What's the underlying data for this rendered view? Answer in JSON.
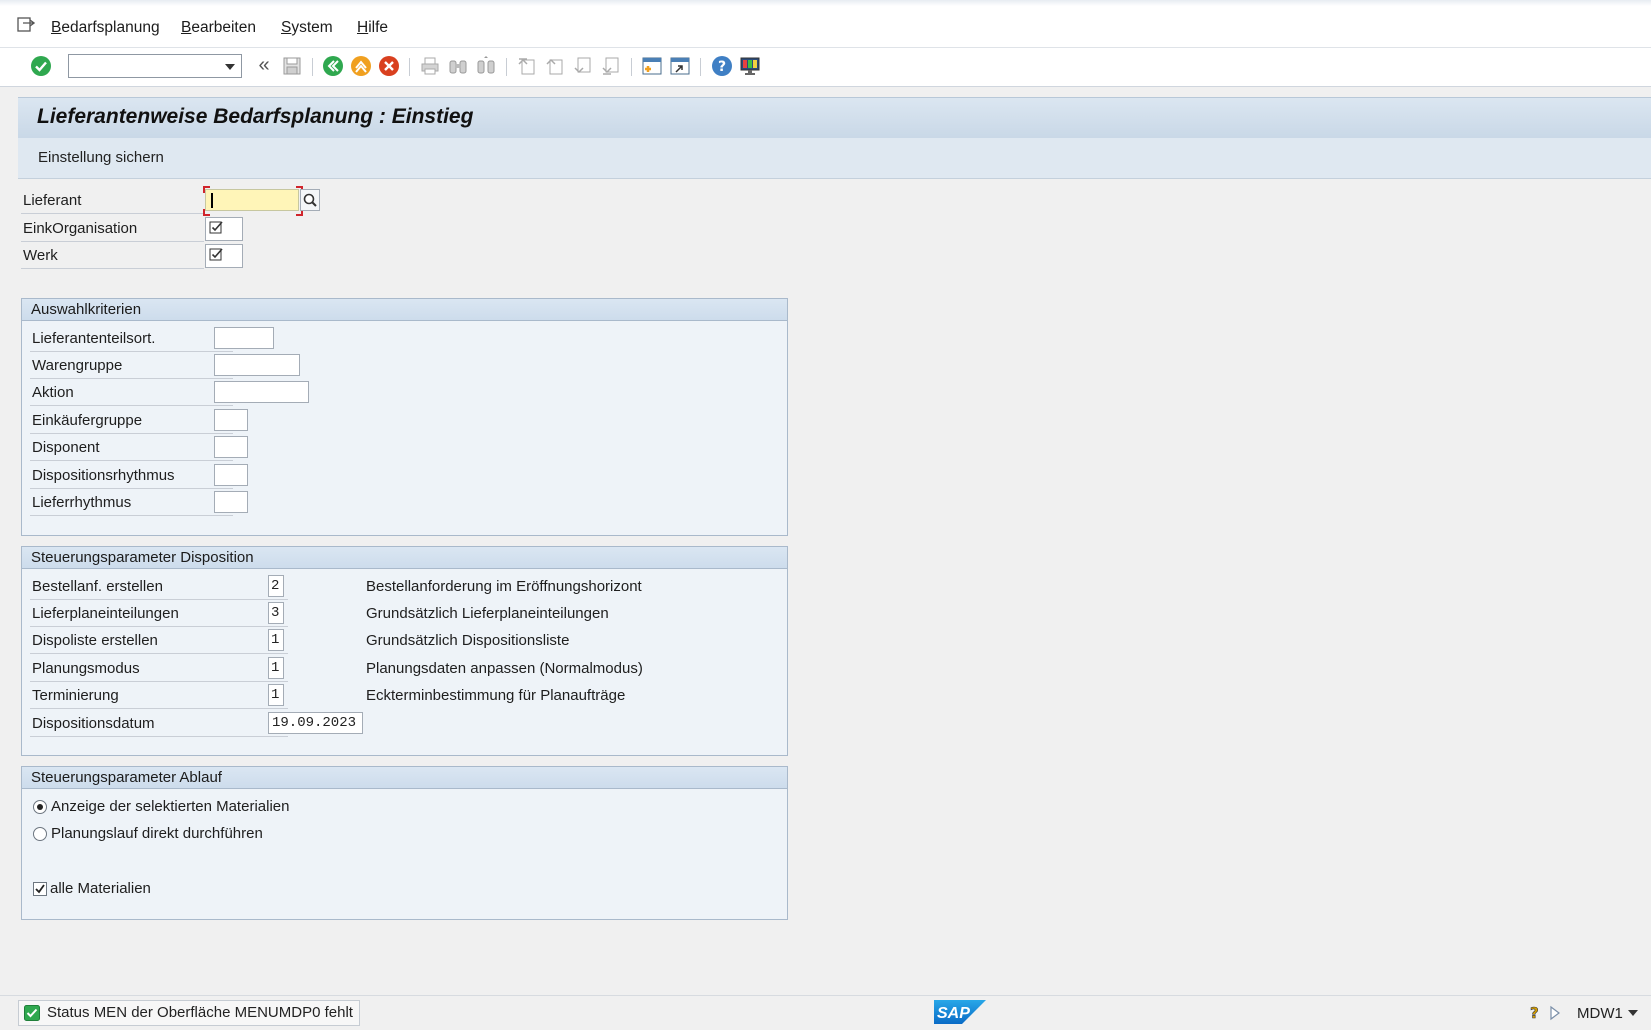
{
  "menu": {
    "items": [
      {
        "underline": "B",
        "rest": "edarfsplanung"
      },
      {
        "underline": "B",
        "rest": "earbeiten"
      },
      {
        "underline": "S",
        "rest": "ystem"
      },
      {
        "underline": "H",
        "rest": "ilfe"
      }
    ]
  },
  "toolbar": {
    "command_value": "",
    "back_double_label": "«"
  },
  "title": "Lieferantenweise Bedarfsplanung : Einstieg",
  "app_toolbar": {
    "save_settings_label": "Einstellung sichern"
  },
  "header_fields": {
    "lieferant_label": "Lieferant",
    "lieferant_value": "",
    "einkorg_label": "EinkOrganisation",
    "werk_label": "Werk"
  },
  "auswahl": {
    "title": "Auswahlkriterien",
    "fields": [
      {
        "label": "Lieferantenteilsort.",
        "value": ""
      },
      {
        "label": "Warengruppe",
        "value": ""
      },
      {
        "label": "Aktion",
        "value": ""
      },
      {
        "label": "Einkäufergruppe",
        "value": ""
      },
      {
        "label": "Disponent",
        "value": ""
      },
      {
        "label": "Dispositionsrhythmus",
        "value": ""
      },
      {
        "label": "Lieferrhythmus",
        "value": ""
      }
    ]
  },
  "steuerung_dispo": {
    "title": "Steuerungsparameter Disposition",
    "rows": [
      {
        "label": "Bestellanf. erstellen",
        "value": "2",
        "desc": "Bestellanforderung im Eröffnungshorizont"
      },
      {
        "label": "Lieferplaneinteilungen",
        "value": "3",
        "desc": "Grundsätzlich Lieferplaneinteilungen"
      },
      {
        "label": "Dispoliste erstellen",
        "value": "1",
        "desc": "Grundsätzlich Dispositionsliste"
      },
      {
        "label": "Planungsmodus",
        "value": "1",
        "desc": "Planungsdaten anpassen (Normalmodus)"
      },
      {
        "label": "Terminierung",
        "value": "1",
        "desc": "Eckterminbestimmung für Planaufträge"
      }
    ],
    "date_label": "Dispositionsdatum",
    "date_value": "19.09.2023"
  },
  "steuerung_ablauf": {
    "title": "Steuerungsparameter Ablauf",
    "radio1": "Anzeige der selektierten Materialien",
    "radio2": "Planungslauf direkt durchführen",
    "checkbox": "alle Materialien"
  },
  "status": {
    "message": "Status MEN der Oberfläche MENUMDP0 fehlt",
    "system": "MDW1",
    "logo": "SAP"
  },
  "colors": {
    "required_field": "#fff5b8",
    "group_header": "#cddcec",
    "ok_green": "#2fa84f",
    "cancel_red": "#d9401f"
  }
}
